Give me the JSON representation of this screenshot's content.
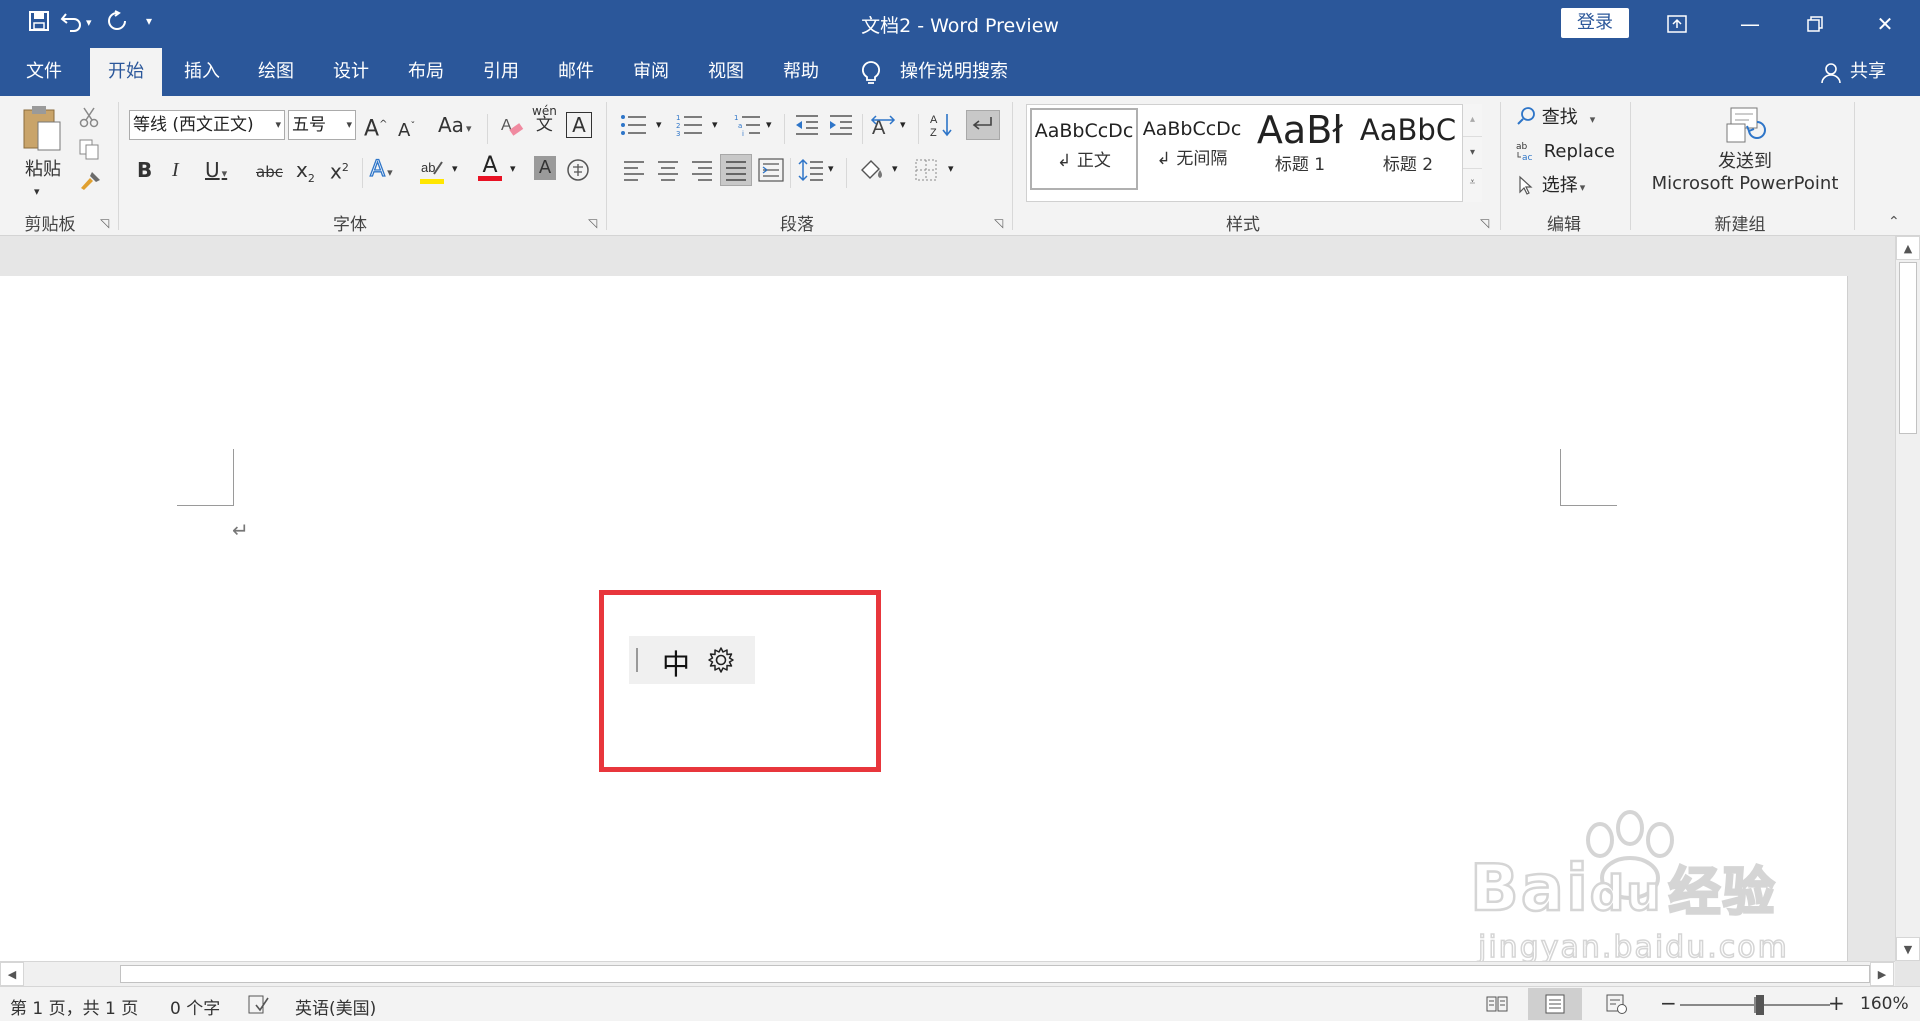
{
  "window": {
    "title": "文档2 - Word Preview",
    "login_label": "登录"
  },
  "tabs": [
    {
      "label": "文件"
    },
    {
      "label": "开始"
    },
    {
      "label": "插入"
    },
    {
      "label": "绘图"
    },
    {
      "label": "设计"
    },
    {
      "label": "布局"
    },
    {
      "label": "引用"
    },
    {
      "label": "邮件"
    },
    {
      "label": "审阅"
    },
    {
      "label": "视图"
    },
    {
      "label": "帮助"
    }
  ],
  "tell_me": "操作说明搜索",
  "share_label": "共享",
  "ribbon": {
    "clipboard": {
      "paste_label": "粘贴",
      "group_label": "剪贴板"
    },
    "font": {
      "font_name": "等线 (西文正文)",
      "font_size": "五号",
      "group_label": "字体",
      "grow": "A",
      "shrink": "A",
      "change_case": "Aa",
      "bold": "B",
      "italic": "I",
      "underline": "U",
      "strike": "abc",
      "subscript": "x",
      "superscript": "x",
      "text_effects": "A",
      "font_color": "A",
      "shading": "A",
      "phonetic": "wén",
      "phonetic_char": "文",
      "char_border": "A"
    },
    "paragraph": {
      "group_label": "段落"
    },
    "styles": {
      "group_label": "样式",
      "items": [
        {
          "sample": "AaBbCcDc",
          "name": "↲ 正文"
        },
        {
          "sample": "AaBbCcDc",
          "name": "↲ 无间隔"
        },
        {
          "sample": "AaBł",
          "name": "标题 1"
        },
        {
          "sample": "AaBbC",
          "name": "标题 2"
        }
      ]
    },
    "editing": {
      "group_label": "编辑",
      "find": "查找",
      "replace": "Replace",
      "select": "选择"
    },
    "newgroup": {
      "group_label": "新建组",
      "send_line1": "发送到",
      "send_line2": "Microsoft PowerPoint"
    }
  },
  "ime": {
    "mode_char": "中"
  },
  "status": {
    "page": "第 1 页，共 1 页",
    "words": "0 个字",
    "language": "英语(美国)",
    "zoom": "160%"
  },
  "watermark": {
    "brand": "Bai",
    "brand2": "du",
    "cn": "经验",
    "url": "jingyan.baidu.com"
  },
  "colors": {
    "title_bar": "#2b579a",
    "highlight_box": "#e8363c",
    "font_color_bar": "#e81123",
    "highlight_color": "#ffe600"
  }
}
